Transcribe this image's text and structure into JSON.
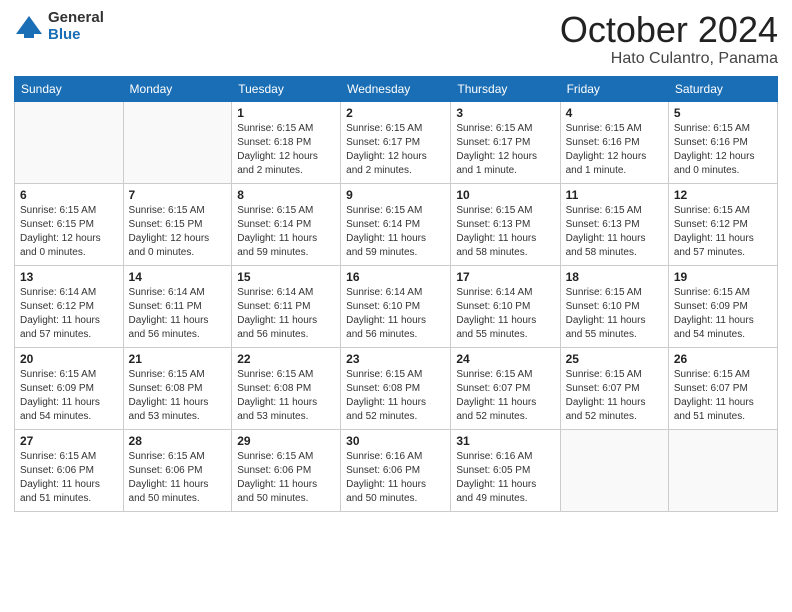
{
  "header": {
    "logo_general": "General",
    "logo_blue": "Blue",
    "month_title": "October 2024",
    "location": "Hato Culantro, Panama"
  },
  "days_of_week": [
    "Sunday",
    "Monday",
    "Tuesday",
    "Wednesday",
    "Thursday",
    "Friday",
    "Saturday"
  ],
  "weeks": [
    [
      {
        "day": "",
        "info": ""
      },
      {
        "day": "",
        "info": ""
      },
      {
        "day": "1",
        "info": "Sunrise: 6:15 AM\nSunset: 6:18 PM\nDaylight: 12 hours and 2 minutes."
      },
      {
        "day": "2",
        "info": "Sunrise: 6:15 AM\nSunset: 6:17 PM\nDaylight: 12 hours and 2 minutes."
      },
      {
        "day": "3",
        "info": "Sunrise: 6:15 AM\nSunset: 6:17 PM\nDaylight: 12 hours and 1 minute."
      },
      {
        "day": "4",
        "info": "Sunrise: 6:15 AM\nSunset: 6:16 PM\nDaylight: 12 hours and 1 minute."
      },
      {
        "day": "5",
        "info": "Sunrise: 6:15 AM\nSunset: 6:16 PM\nDaylight: 12 hours and 0 minutes."
      }
    ],
    [
      {
        "day": "6",
        "info": "Sunrise: 6:15 AM\nSunset: 6:15 PM\nDaylight: 12 hours and 0 minutes."
      },
      {
        "day": "7",
        "info": "Sunrise: 6:15 AM\nSunset: 6:15 PM\nDaylight: 12 hours and 0 minutes."
      },
      {
        "day": "8",
        "info": "Sunrise: 6:15 AM\nSunset: 6:14 PM\nDaylight: 11 hours and 59 minutes."
      },
      {
        "day": "9",
        "info": "Sunrise: 6:15 AM\nSunset: 6:14 PM\nDaylight: 11 hours and 59 minutes."
      },
      {
        "day": "10",
        "info": "Sunrise: 6:15 AM\nSunset: 6:13 PM\nDaylight: 11 hours and 58 minutes."
      },
      {
        "day": "11",
        "info": "Sunrise: 6:15 AM\nSunset: 6:13 PM\nDaylight: 11 hours and 58 minutes."
      },
      {
        "day": "12",
        "info": "Sunrise: 6:15 AM\nSunset: 6:12 PM\nDaylight: 11 hours and 57 minutes."
      }
    ],
    [
      {
        "day": "13",
        "info": "Sunrise: 6:14 AM\nSunset: 6:12 PM\nDaylight: 11 hours and 57 minutes."
      },
      {
        "day": "14",
        "info": "Sunrise: 6:14 AM\nSunset: 6:11 PM\nDaylight: 11 hours and 56 minutes."
      },
      {
        "day": "15",
        "info": "Sunrise: 6:14 AM\nSunset: 6:11 PM\nDaylight: 11 hours and 56 minutes."
      },
      {
        "day": "16",
        "info": "Sunrise: 6:14 AM\nSunset: 6:10 PM\nDaylight: 11 hours and 56 minutes."
      },
      {
        "day": "17",
        "info": "Sunrise: 6:14 AM\nSunset: 6:10 PM\nDaylight: 11 hours and 55 minutes."
      },
      {
        "day": "18",
        "info": "Sunrise: 6:15 AM\nSunset: 6:10 PM\nDaylight: 11 hours and 55 minutes."
      },
      {
        "day": "19",
        "info": "Sunrise: 6:15 AM\nSunset: 6:09 PM\nDaylight: 11 hours and 54 minutes."
      }
    ],
    [
      {
        "day": "20",
        "info": "Sunrise: 6:15 AM\nSunset: 6:09 PM\nDaylight: 11 hours and 54 minutes."
      },
      {
        "day": "21",
        "info": "Sunrise: 6:15 AM\nSunset: 6:08 PM\nDaylight: 11 hours and 53 minutes."
      },
      {
        "day": "22",
        "info": "Sunrise: 6:15 AM\nSunset: 6:08 PM\nDaylight: 11 hours and 53 minutes."
      },
      {
        "day": "23",
        "info": "Sunrise: 6:15 AM\nSunset: 6:08 PM\nDaylight: 11 hours and 52 minutes."
      },
      {
        "day": "24",
        "info": "Sunrise: 6:15 AM\nSunset: 6:07 PM\nDaylight: 11 hours and 52 minutes."
      },
      {
        "day": "25",
        "info": "Sunrise: 6:15 AM\nSunset: 6:07 PM\nDaylight: 11 hours and 52 minutes."
      },
      {
        "day": "26",
        "info": "Sunrise: 6:15 AM\nSunset: 6:07 PM\nDaylight: 11 hours and 51 minutes."
      }
    ],
    [
      {
        "day": "27",
        "info": "Sunrise: 6:15 AM\nSunset: 6:06 PM\nDaylight: 11 hours and 51 minutes."
      },
      {
        "day": "28",
        "info": "Sunrise: 6:15 AM\nSunset: 6:06 PM\nDaylight: 11 hours and 50 minutes."
      },
      {
        "day": "29",
        "info": "Sunrise: 6:15 AM\nSunset: 6:06 PM\nDaylight: 11 hours and 50 minutes."
      },
      {
        "day": "30",
        "info": "Sunrise: 6:16 AM\nSunset: 6:06 PM\nDaylight: 11 hours and 50 minutes."
      },
      {
        "day": "31",
        "info": "Sunrise: 6:16 AM\nSunset: 6:05 PM\nDaylight: 11 hours and 49 minutes."
      },
      {
        "day": "",
        "info": ""
      },
      {
        "day": "",
        "info": ""
      }
    ]
  ]
}
